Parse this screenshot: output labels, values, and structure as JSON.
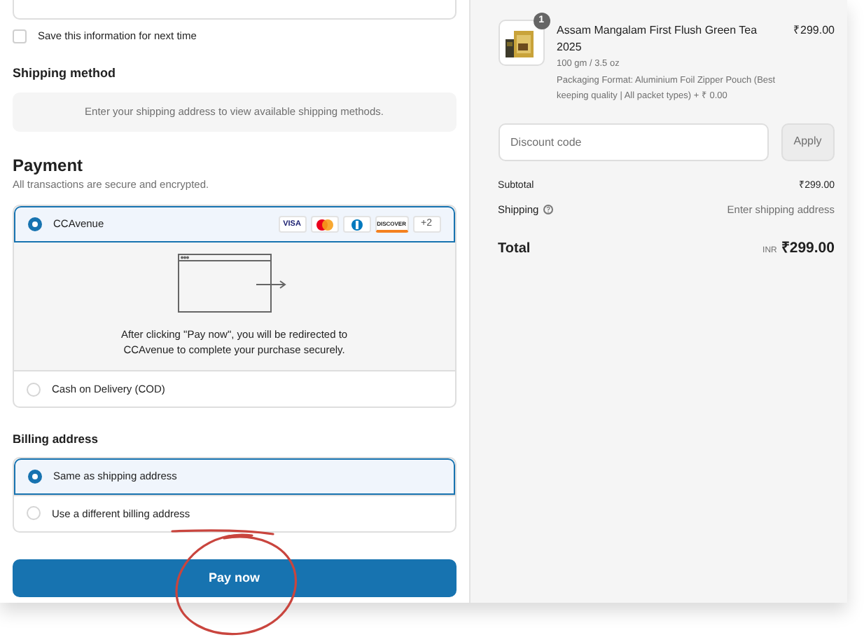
{
  "contact_form": {
    "save_info": {
      "label": "Save this information for next time",
      "checked": false
    }
  },
  "shipping_method": {
    "title": "Shipping method",
    "message": "Enter your shipping address to view available shipping methods."
  },
  "payment": {
    "title": "Payment",
    "subtitle": "All transactions are secure and encrypted.",
    "methods": [
      {
        "label": "CCAvenue",
        "selected": true,
        "cards": [
          {
            "kind": "visa",
            "label": "VISA"
          },
          {
            "kind": "mastercard"
          },
          {
            "kind": "diners"
          },
          {
            "kind": "discover",
            "label": "DISCOVER"
          },
          {
            "kind": "more",
            "label": "+2"
          }
        ],
        "redirect_message": "After clicking \"Pay now\", you will be redirected to CCAvenue to complete your purchase securely."
      },
      {
        "label": "Cash on Delivery (COD)",
        "selected": false
      }
    ]
  },
  "billing_address": {
    "title": "Billing address",
    "options": [
      {
        "label": "Same as shipping address",
        "selected": true
      },
      {
        "label": "Use a different billing address",
        "selected": false
      }
    ]
  },
  "pay_button": "Pay now",
  "order_summary": {
    "items": [
      {
        "quantity": "1",
        "name": "Assam Mangalam First Flush Green Tea 2025",
        "variant": "100 gm / 3.5 oz",
        "option": "Packaging Format: Aluminium Foil Zipper Pouch (Best keeping quality | All packet types) + ₹ 0.00",
        "price": "₹299.00"
      }
    ],
    "discount": {
      "placeholder": "Discount code",
      "button": "Apply"
    },
    "subtotal": {
      "label": "Subtotal",
      "value": "₹299.00"
    },
    "shipping": {
      "label": "Shipping",
      "value": "Enter shipping address"
    },
    "total": {
      "label": "Total",
      "currency": "INR",
      "value": "₹299.00"
    }
  }
}
